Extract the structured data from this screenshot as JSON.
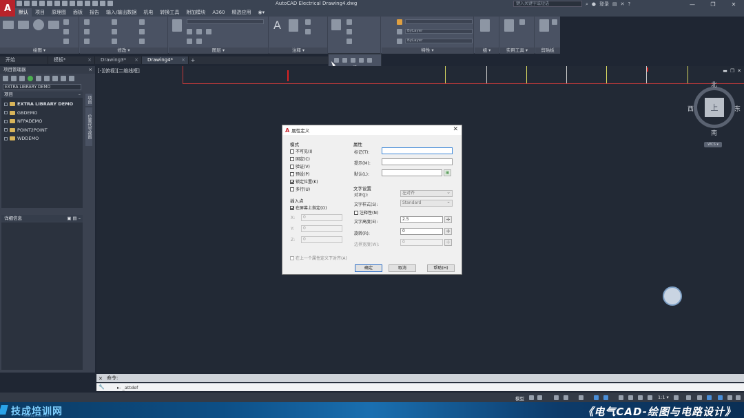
{
  "window": {
    "app_logo": "A",
    "title": "AutoCAD Electrical    Drawing4.dwg",
    "search_placeholder": "键入关键字或短语",
    "user_label": "登录",
    "help": "?",
    "controls": [
      "—",
      "❐",
      "✕"
    ]
  },
  "ribbon_tabs": [
    {
      "label": "默认",
      "active": true
    },
    {
      "label": "项目"
    },
    {
      "label": "原理图"
    },
    {
      "label": "面板"
    },
    {
      "label": "报告"
    },
    {
      "label": "输入/输出数据"
    },
    {
      "label": "机电"
    },
    {
      "label": "转换工具"
    },
    {
      "label": "附加模块"
    },
    {
      "label": "A360"
    },
    {
      "label": "精选应用"
    }
  ],
  "ribbon_panels": {
    "draw": "绘图 ▾",
    "modify": "修改 ▾",
    "layers": "图层 ▾",
    "annotation": "注释 ▾",
    "properties": "特性 ▾",
    "groups": "组 ▾",
    "utilities": "实用工具 ▾",
    "clipboard": "剪贴板",
    "block": "块",
    "bylayer_1": "ByLayer",
    "bylayer_2": "ByLayer",
    "bylayer_3": "ByLayer"
  },
  "doc_tabs": [
    {
      "label": "开始"
    },
    {
      "label": "模板*"
    },
    {
      "label": "Drawing3*"
    },
    {
      "label": "Drawing4*",
      "active": true
    }
  ],
  "doc_tab_add": "+",
  "project_manager": {
    "title": "项目管理器",
    "active_project": "EXTRA LIBRARY DEMO",
    "projects_header": "项目",
    "projects": [
      {
        "label": "EXTRA LIBRARY DEMO",
        "bold": true
      },
      {
        "label": "GBDEMO"
      },
      {
        "label": "NFPADEMO"
      },
      {
        "label": "POINT2POINT"
      },
      {
        "label": "WDDEMO"
      }
    ],
    "side_tabs": [
      "项目",
      "位置代号视图"
    ],
    "details_header": "详细信息"
  },
  "canvas": {
    "viewport_label": "[-][俯视][二维线框]",
    "viewcube": {
      "face": "上",
      "north": "北",
      "south": "南",
      "east": "东",
      "west": "西",
      "wcs": "WCS ▾"
    }
  },
  "dialog": {
    "title": "属性定义",
    "mode": {
      "label": "模式",
      "options": [
        {
          "label": "不可见(I)",
          "checked": false
        },
        {
          "label": "固定(C)",
          "checked": false
        },
        {
          "label": "验证(V)",
          "checked": false
        },
        {
          "label": "预设(P)",
          "checked": false
        },
        {
          "label": "锁定位置(K)",
          "checked": true
        },
        {
          "label": "多行(U)",
          "checked": false
        }
      ]
    },
    "insertion": {
      "label": "插入点",
      "specify_on_screen": "在屏幕上指定(O)",
      "x_label": "X:",
      "x_value": "0",
      "y_label": "Y:",
      "y_value": "0",
      "z_label": "Z:",
      "z_value": "0"
    },
    "attribute": {
      "label": "属性",
      "tag_label": "标记(T):",
      "tag_value": "",
      "prompt_label": "提示(M):",
      "prompt_value": "",
      "default_label": "默认(L):",
      "default_value": ""
    },
    "text_settings": {
      "label": "文字设置",
      "justify_label": "对正(J):",
      "justify_value": "左对齐",
      "style_label": "文字样式(S):",
      "style_value": "Standard",
      "annotative_label": "注释性(N)",
      "height_label": "文字高度(E):",
      "height_value": "2.5",
      "rotation_label": "旋转(R):",
      "rotation_value": "0",
      "boundary_label": "边界宽度(W):",
      "boundary_value": "0"
    },
    "align_below": "在上一个属性定义下对齐(A)",
    "buttons": {
      "ok": "确定",
      "cancel": "取消",
      "help": "帮助(H)"
    }
  },
  "command": {
    "history": "命令:",
    "input": "▸- _attdef"
  },
  "status": {
    "model": "模型",
    "scale": "1:1 ▾"
  },
  "banner": {
    "brand": "技成培训网",
    "brand_url": "www.jcpeixun.com",
    "course_title": "《电气CAD-绘图与电路设计》"
  }
}
